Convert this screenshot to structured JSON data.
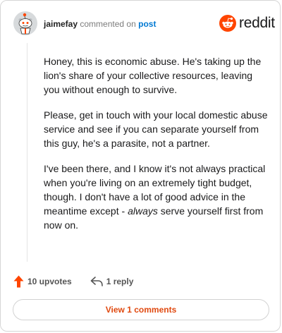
{
  "header": {
    "username": "jaimefay",
    "action": "commented on",
    "post_link": "post",
    "brand": "reddit"
  },
  "comment": {
    "p1": "Honey, this is economic abuse. He's taking up the lion's share of your collective resources, leaving you without enough to survive.",
    "p2": "Please, get in touch with your local domestic abuse service and see if you can separate yourself from this guy, he's a parasite, not a partner.",
    "p3_before": "I've been there, and I know it's not always practical when you're living on an extremely tight budget, though. I don't have a lot of good advice in the meantime except - ",
    "p3_emphasis": "always",
    "p3_after": " serve yourself first from now on."
  },
  "footer": {
    "upvotes": "10 upvotes",
    "replies": "1 reply",
    "view_comments": "View 1 comments"
  },
  "colors": {
    "brand_orange": "#ff4500",
    "link_blue": "#0079d3",
    "upvote_orange": "#ff4500"
  },
  "icons": {
    "avatar": "snoo-avatar-icon",
    "brand": "reddit-logo-icon",
    "upvote": "upvote-arrow-icon",
    "reply": "reply-arrow-icon"
  }
}
